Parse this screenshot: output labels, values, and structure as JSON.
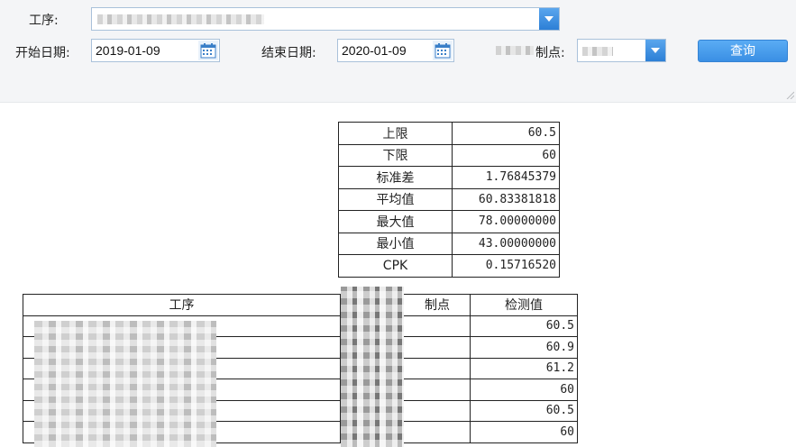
{
  "filters": {
    "process_label": "工序:",
    "start_date_label": "开始日期:",
    "start_date": "2019-01-09",
    "end_date_label": "结束日期:",
    "end_date": "2020-01-09",
    "control_point_label_suffix": "制点:",
    "query_button": "查询"
  },
  "stats": [
    {
      "label": "上限",
      "value": "60.5"
    },
    {
      "label": "下限",
      "value": "60"
    },
    {
      "label": "标准差",
      "value": "1.76845379"
    },
    {
      "label": "平均值",
      "value": "60.83381818"
    },
    {
      "label": "最大值",
      "value": "78.00000000"
    },
    {
      "label": "最小值",
      "value": "43.00000000"
    },
    {
      "label": "CPK",
      "value": "0.15716520"
    }
  ],
  "detail": {
    "headers": {
      "process": "工序",
      "control_point_suffix": "制点",
      "value": "检测值"
    },
    "values": [
      "60.5",
      "60.9",
      "61.2",
      "60",
      "60.5",
      "60"
    ]
  },
  "colors": {
    "accent": "#3a8fe4",
    "toolbar_bg": "#f4f5f7"
  }
}
